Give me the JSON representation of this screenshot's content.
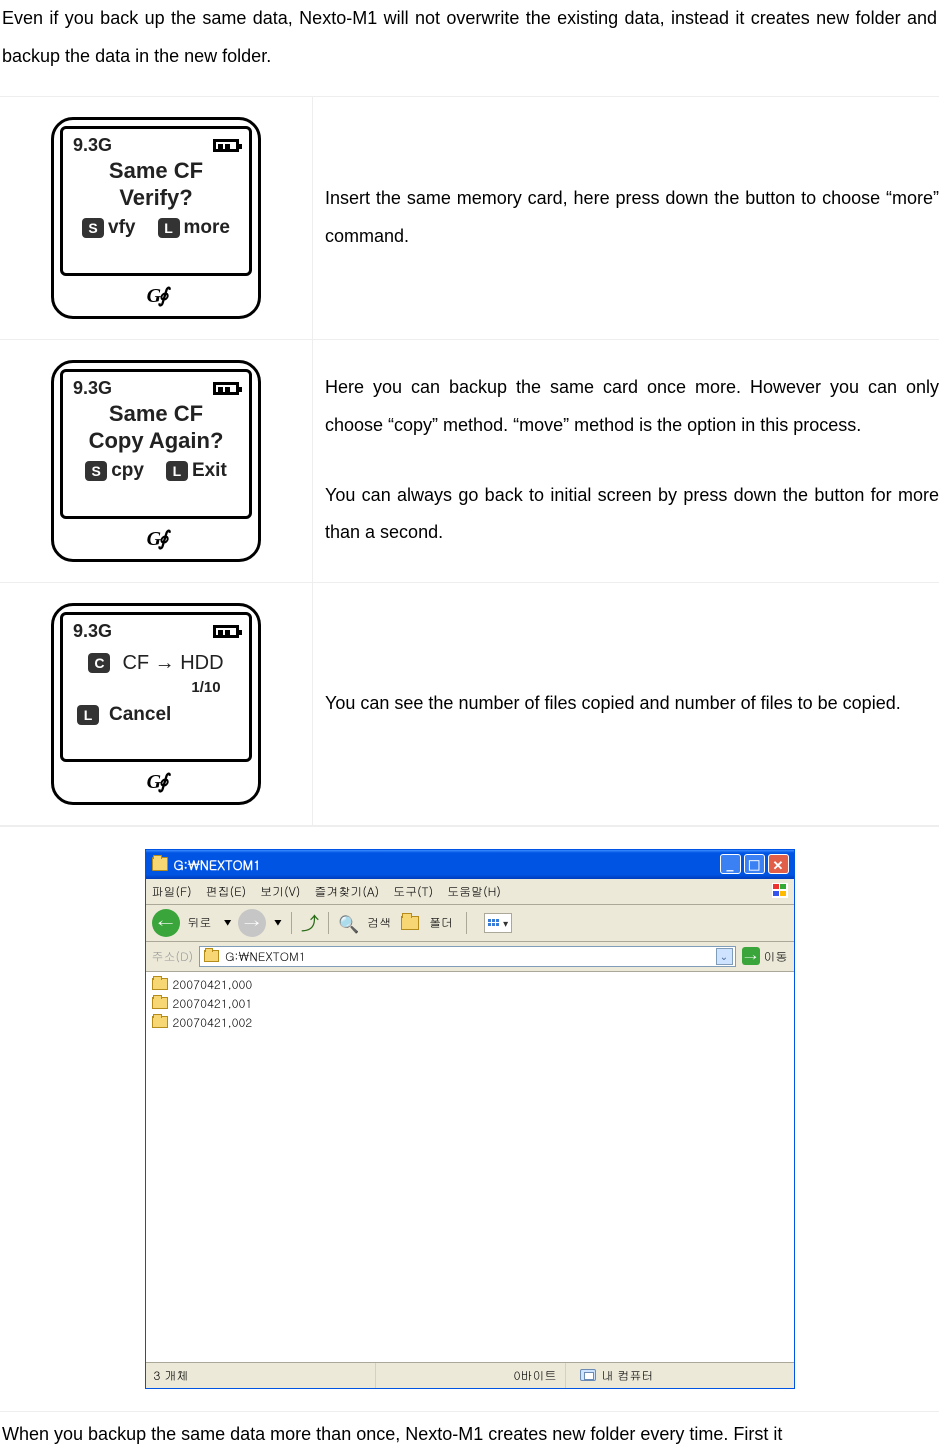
{
  "intro": "Even if you back up the same data, Nexto-M1 will not overwrite the existing data, instead it creates new folder and backup the data in the new folder.",
  "rows": [
    {
      "screen": {
        "capacity": "9.3G",
        "line1": "Same CF",
        "line2": "Verify?",
        "left_key": "S",
        "left_label": "vfy",
        "right_key": "L",
        "right_label": "more"
      },
      "text_a": "Insert the same memory card, here press down the button to choose “more” command.",
      "text_b": ""
    },
    {
      "screen": {
        "capacity": "9.3G",
        "line1": "Same CF",
        "line2": "Copy Again?",
        "left_key": "S",
        "left_label": "cpy",
        "right_key": "L",
        "right_label": "Exit"
      },
      "text_a": "Here you can backup the same card once more. However you can only choose “copy” method. “move” method is the option in this process.",
      "text_b": "You can always go back to initial screen by press down the button for more than a second."
    },
    {
      "screen": {
        "capacity": "9.3G",
        "progress_key": "C",
        "progress_label": "CF → HDD",
        "progress_count": "1/10",
        "cancel_key": "L",
        "cancel_label": "Cancel"
      },
      "text_a": "You can see the number of files copied and number of files to be copied.",
      "text_b": ""
    }
  ],
  "brand": "G∮",
  "explorer": {
    "title": "G:₩NEXTOM1",
    "menu": {
      "file": "파일(F)",
      "edit": "편집(E)",
      "view": "보기(V)",
      "fav": "즐겨찾기(A)",
      "tools": "도구(T)",
      "help": "도움말(H)"
    },
    "toolbar": {
      "back": "뒤로",
      "search": "검색",
      "folders": "폴더"
    },
    "address": {
      "label": "주소(D)",
      "value": "G:₩NEXTOM1",
      "go": "이동"
    },
    "folders": [
      "20070421,000",
      "20070421,001",
      "20070421,002"
    ],
    "status": {
      "count": "3 개체",
      "size": "0바이트",
      "loc": "내 컴퓨터"
    }
  },
  "outro": "When you backup the same data more than once, Nexto-M1 creates new folder every time. First it"
}
